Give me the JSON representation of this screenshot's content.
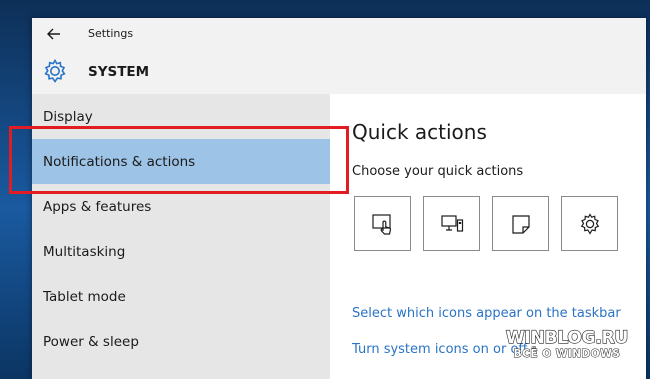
{
  "window": {
    "title": "Settings"
  },
  "header": {
    "title": "SYSTEM"
  },
  "sidebar": {
    "items": [
      {
        "label": "Display"
      },
      {
        "label": "Notifications & actions"
      },
      {
        "label": "Apps & features"
      },
      {
        "label": "Multitasking"
      },
      {
        "label": "Tablet mode"
      },
      {
        "label": "Power & sleep"
      }
    ],
    "selected_index": 1
  },
  "main": {
    "title": "Quick actions",
    "subtitle": "Choose your quick actions",
    "tiles": [
      {
        "icon": "tablet-mode-icon"
      },
      {
        "icon": "connect-icon"
      },
      {
        "icon": "note-icon"
      },
      {
        "icon": "settings-gear-icon"
      }
    ],
    "links": [
      {
        "label": "Select which icons appear on the taskbar"
      },
      {
        "label": "Turn system icons on or off"
      }
    ]
  },
  "watermark": {
    "main": "WINBLOG.RU",
    "sub": "ВСЁ О WINDOWS"
  },
  "colors": {
    "accent": "#9dc3e6",
    "link": "#2a73c5",
    "highlight": "#e31b23"
  }
}
